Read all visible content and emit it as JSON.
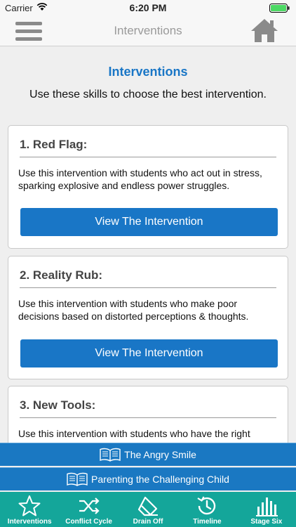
{
  "status_bar": {
    "carrier": "Carrier",
    "time": "6:20 PM"
  },
  "nav": {
    "title": "Interventions"
  },
  "page": {
    "heading": "Interventions",
    "subtitle": "Use these skills to choose the best intervention."
  },
  "cards": [
    {
      "title": "1. Red Flag:",
      "description": "Use this intervention with students who act out in stress, sparking explosive and endless power struggles.",
      "button": "View The Intervention"
    },
    {
      "title": "2. Reality Rub:",
      "description": "Use this intervention with students who make poor decisions based on distorted perceptions & thoughts.",
      "button": "View The Intervention"
    },
    {
      "title": "3. New Tools:",
      "description": "Use this intervention with students who have the right intentions but lack the social skills to be successful."
    }
  ],
  "links": [
    {
      "label": "The Angry Smile",
      "icon": "book-icon"
    },
    {
      "label": "Parenting the Challenging Child",
      "icon": "book-icon"
    }
  ],
  "tabs": [
    {
      "label": "Interventions",
      "icon": "star-icon"
    },
    {
      "label": "Conflict Cycle",
      "icon": "shuffle-icon"
    },
    {
      "label": "Drain Off",
      "icon": "eraser-icon"
    },
    {
      "label": "Timeline",
      "icon": "history-icon"
    },
    {
      "label": "Stage Six",
      "icon": "bar-chart-icon"
    }
  ],
  "colors": {
    "accent": "#1976c6",
    "tabbar": "#14a69a",
    "link_bar": "#1a78c2"
  }
}
